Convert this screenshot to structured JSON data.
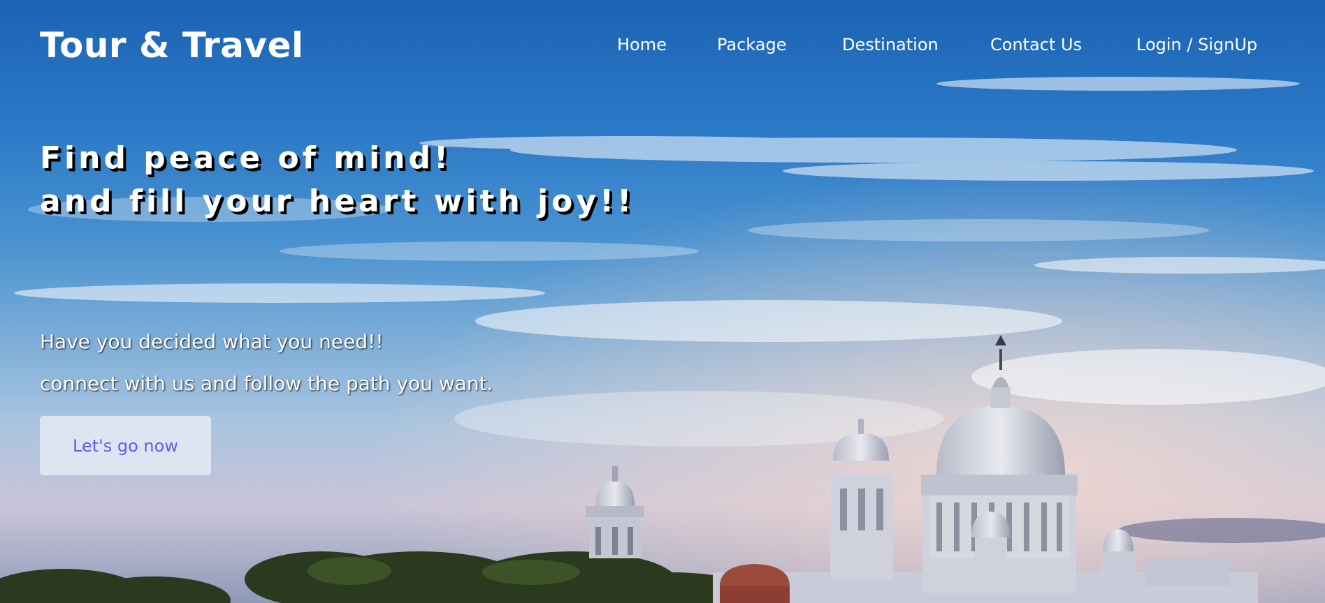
{
  "brand": {
    "name": "Tour & Travel"
  },
  "nav": {
    "items": [
      {
        "label": "Home"
      },
      {
        "label": "Package"
      },
      {
        "label": "Destination"
      },
      {
        "label": "Contact Us"
      },
      {
        "label": "Login / SignUp"
      }
    ]
  },
  "hero": {
    "headline_line1": "Find peace of mind!",
    "headline_line2": "and fill your heart with joy!!",
    "subtext_line1": "Have you decided what you need!!",
    "subtext_line2": "connect with us and follow the path you want.",
    "cta_label": "Let's go now"
  },
  "colors": {
    "text": "#ffffff",
    "cta_text": "#5f5ee8",
    "cta_background": "#e2e9f5",
    "sky": "#2c7ac7"
  },
  "images": {
    "background": "sky-with-clouds-and-domed-palace-photo"
  }
}
